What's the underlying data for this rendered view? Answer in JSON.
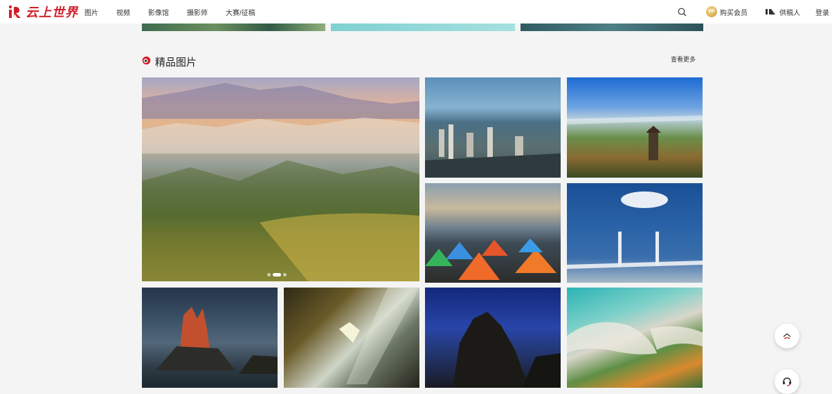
{
  "header": {
    "logo_text": "云上世界",
    "nav": [
      {
        "label": "图片"
      },
      {
        "label": "视频"
      },
      {
        "label": "影像馆"
      },
      {
        "label": "摄影师"
      },
      {
        "label": "大赛/征稿"
      }
    ],
    "vip_badge": "VIP",
    "vip_label": "购买会员",
    "supplier_label": "供稿人",
    "login_label": "登录"
  },
  "section": {
    "title": "精品图片",
    "more_label": "查看更多"
  },
  "gallery": {
    "tiles": [
      {
        "subject": "terraced-fields-sea-of-clouds"
      },
      {
        "subject": "coastal-city-aerial"
      },
      {
        "subject": "pagoda-lakeside-city"
      },
      {
        "subject": "camping-tents-seaside"
      },
      {
        "subject": "cable-stayed-bridge"
      },
      {
        "subject": "sea-stack-sunset"
      },
      {
        "subject": "cave-light-beams"
      },
      {
        "subject": "rock-peak-night"
      },
      {
        "subject": "coastline-aerial"
      }
    ],
    "carousel": {
      "count": 3,
      "active": 1
    }
  },
  "colors": {
    "brand_red": "#d0202a",
    "background": "#f4f4f4",
    "vip_gold": "#c99a3a"
  },
  "icons": {
    "search": "search-icon",
    "vip": "vip-badge-icon",
    "supplier": "supplier-icon",
    "section": "section-dot-icon",
    "back_to_top": "chevron-up-icon",
    "service": "headset-icon"
  }
}
